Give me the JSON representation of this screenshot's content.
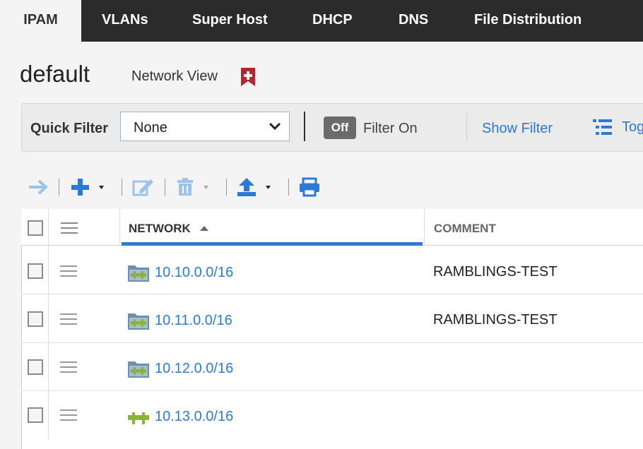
{
  "nav": {
    "tabs": [
      {
        "label": "IPAM",
        "active": true
      },
      {
        "label": "VLANs"
      },
      {
        "label": "Super Host"
      },
      {
        "label": "DHCP"
      },
      {
        "label": "DNS"
      },
      {
        "label": "File Distribution"
      }
    ]
  },
  "header": {
    "title": "default",
    "view_label": "Network View",
    "bookmark_icon": "bookmark-plus-icon"
  },
  "filter": {
    "quick_filter_label": "Quick Filter",
    "quick_filter_value": "None",
    "toggle_state": "Off",
    "filter_on_label": "Filter On",
    "show_filter_label": "Show Filter",
    "toggle_view_label": "Tog"
  },
  "toolbar": {
    "icons": [
      "arrow-right-icon",
      "add-icon",
      "edit-icon",
      "delete-icon",
      "upload-icon",
      "print-icon"
    ]
  },
  "table": {
    "columns": [
      {
        "label": "NETWORK",
        "sorted": "asc"
      },
      {
        "label": "COMMENT"
      }
    ],
    "rows": [
      {
        "network": "10.10.0.0/16",
        "comment": "RAMBLINGS-TEST",
        "icon": "network-container-icon"
      },
      {
        "network": "10.11.0.0/16",
        "comment": "RAMBLINGS-TEST",
        "icon": "network-container-icon"
      },
      {
        "network": "10.12.0.0/16",
        "comment": "",
        "icon": "network-container-icon"
      },
      {
        "network": "10.13.0.0/16",
        "comment": "",
        "icon": "network-icon"
      }
    ]
  },
  "colors": {
    "accent": "#2d7ad6",
    "nav_bg": "#2b2b2b",
    "bookmark": "#b3262d",
    "network_green": "#8cb33a"
  }
}
